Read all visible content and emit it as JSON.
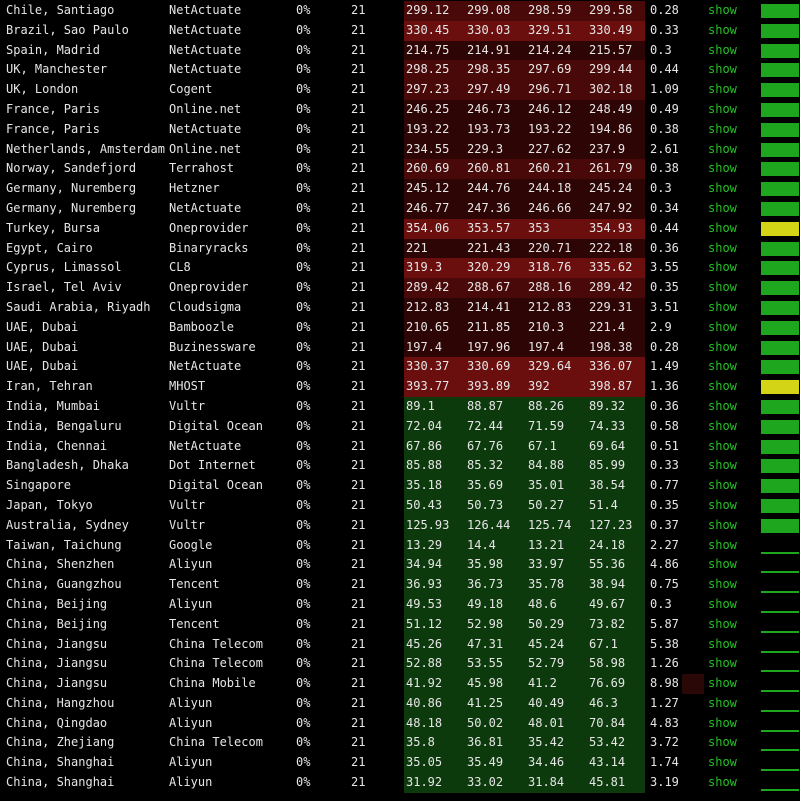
{
  "colors": {
    "band_red_strong": "#6b0e0e",
    "band_red_mid": "#4a0909",
    "band_red_dark": "#2d0505",
    "band_green": "#0d3a0d",
    "link_green": "#25c025",
    "bar_green": "#1ea61e",
    "bar_yellow": "#d4d417"
  },
  "link_label": "show",
  "rows": [
    {
      "location": "Chile, Santiago",
      "provider": "NetActuate",
      "loss": "0%",
      "sent": "21",
      "last": "299.12",
      "avg": "299.08",
      "best": "298.59",
      "worst": "299.58",
      "stdev": "0.28",
      "band": "red",
      "bar": "green"
    },
    {
      "location": "Brazil, Sao Paulo",
      "provider": "NetActuate",
      "loss": "0%",
      "sent": "21",
      "last": "330.45",
      "avg": "330.03",
      "best": "329.51",
      "worst": "330.49",
      "stdev": "0.33",
      "band": "red_strong",
      "bar": "green"
    },
    {
      "location": "Spain, Madrid",
      "provider": "NetActuate",
      "loss": "0%",
      "sent": "21",
      "last": "214.75",
      "avg": "214.91",
      "best": "214.24",
      "worst": "215.57",
      "stdev": "0.3",
      "band": "red_dark",
      "bar": "green"
    },
    {
      "location": "UK, Manchester",
      "provider": "NetActuate",
      "loss": "0%",
      "sent": "21",
      "last": "298.25",
      "avg": "298.35",
      "best": "297.69",
      "worst": "299.44",
      "stdev": "0.44",
      "band": "red",
      "bar": "green"
    },
    {
      "location": "UK, London",
      "provider": "Cogent",
      "loss": "0%",
      "sent": "21",
      "last": "297.23",
      "avg": "297.49",
      "best": "296.71",
      "worst": "302.18",
      "stdev": "1.09",
      "band": "red",
      "bar": "green"
    },
    {
      "location": "France, Paris",
      "provider": "Online.net",
      "loss": "0%",
      "sent": "21",
      "last": "246.25",
      "avg": "246.73",
      "best": "246.12",
      "worst": "248.49",
      "stdev": "0.49",
      "band": "red_dark",
      "bar": "green"
    },
    {
      "location": "France, Paris",
      "provider": "NetActuate",
      "loss": "0%",
      "sent": "21",
      "last": "193.22",
      "avg": "193.73",
      "best": "193.22",
      "worst": "194.86",
      "stdev": "0.38",
      "band": "red_dark",
      "bar": "green"
    },
    {
      "location": "Netherlands, Amsterdam",
      "provider": "Online.net",
      "loss": "0%",
      "sent": "21",
      "last": "234.55",
      "avg": "229.3",
      "best": "227.62",
      "worst": "237.9",
      "stdev": "2.61",
      "band": "red_dark",
      "bar": "green"
    },
    {
      "location": "Norway, Sandefjord",
      "provider": "Terrahost",
      "loss": "0%",
      "sent": "21",
      "last": "260.69",
      "avg": "260.81",
      "best": "260.21",
      "worst": "261.79",
      "stdev": "0.38",
      "band": "red",
      "bar": "green"
    },
    {
      "location": "Germany, Nuremberg",
      "provider": "Hetzner",
      "loss": "0%",
      "sent": "21",
      "last": "245.12",
      "avg": "244.76",
      "best": "244.18",
      "worst": "245.24",
      "stdev": "0.3",
      "band": "red_dark",
      "bar": "green"
    },
    {
      "location": "Germany, Nuremberg",
      "provider": "NetActuate",
      "loss": "0%",
      "sent": "21",
      "last": "246.77",
      "avg": "247.36",
      "best": "246.66",
      "worst": "247.92",
      "stdev": "0.34",
      "band": "red_dark",
      "bar": "green"
    },
    {
      "location": "Turkey, Bursa",
      "provider": "Oneprovider",
      "loss": "0%",
      "sent": "21",
      "last": "354.06",
      "avg": "353.57",
      "best": "353",
      "worst": "354.93",
      "stdev": "0.44",
      "band": "red_strong",
      "bar": "yellow"
    },
    {
      "location": "Egypt, Cairo",
      "provider": "Binaryracks",
      "loss": "0%",
      "sent": "21",
      "last": "221",
      "avg": "221.43",
      "best": "220.71",
      "worst": "222.18",
      "stdev": "0.36",
      "band": "red_dark",
      "bar": "green"
    },
    {
      "location": "Cyprus, Limassol",
      "provider": "CL8",
      "loss": "0%",
      "sent": "21",
      "last": "319.3",
      "avg": "320.29",
      "best": "318.76",
      "worst": "335.62",
      "stdev": "3.55",
      "band": "red_strong",
      "bar": "green"
    },
    {
      "location": "Israel, Tel Aviv",
      "provider": "Oneprovider",
      "loss": "0%",
      "sent": "21",
      "last": "289.42",
      "avg": "288.67",
      "best": "288.16",
      "worst": "289.42",
      "stdev": "0.35",
      "band": "red",
      "bar": "green"
    },
    {
      "location": "Saudi Arabia, Riyadh",
      "provider": "Cloudsigma",
      "loss": "0%",
      "sent": "21",
      "last": "212.83",
      "avg": "214.41",
      "best": "212.83",
      "worst": "229.31",
      "stdev": "3.51",
      "band": "red_dark",
      "bar": "green"
    },
    {
      "location": "UAE, Dubai",
      "provider": "Bamboozle",
      "loss": "0%",
      "sent": "21",
      "last": "210.65",
      "avg": "211.85",
      "best": "210.3",
      "worst": "221.4",
      "stdev": "2.9",
      "band": "red_dark",
      "bar": "green"
    },
    {
      "location": "UAE, Dubai",
      "provider": "Buzinessware",
      "loss": "0%",
      "sent": "21",
      "last": "197.4",
      "avg": "197.96",
      "best": "197.4",
      "worst": "198.38",
      "stdev": "0.28",
      "band": "red_dark",
      "bar": "green"
    },
    {
      "location": "UAE, Dubai",
      "provider": "NetActuate",
      "loss": "0%",
      "sent": "21",
      "last": "330.37",
      "avg": "330.69",
      "best": "329.64",
      "worst": "336.07",
      "stdev": "1.49",
      "band": "red_strong",
      "bar": "green"
    },
    {
      "location": "Iran, Tehran",
      "provider": "MHOST",
      "loss": "0%",
      "sent": "21",
      "last": "393.77",
      "avg": "393.89",
      "best": "392",
      "worst": "398.87",
      "stdev": "1.36",
      "band": "red_strong",
      "bar": "yellow"
    },
    {
      "location": "India, Mumbai",
      "provider": "Vultr",
      "loss": "0%",
      "sent": "21",
      "last": "89.1",
      "avg": "88.87",
      "best": "88.26",
      "worst": "89.32",
      "stdev": "0.36",
      "band": "green",
      "bar": "green"
    },
    {
      "location": "India, Bengaluru",
      "provider": "Digital Ocean",
      "loss": "0%",
      "sent": "21",
      "last": "72.04",
      "avg": "72.44",
      "best": "71.59",
      "worst": "74.33",
      "stdev": "0.58",
      "band": "green",
      "bar": "green"
    },
    {
      "location": "India, Chennai",
      "provider": "NetActuate",
      "loss": "0%",
      "sent": "21",
      "last": "67.86",
      "avg": "67.76",
      "best": "67.1",
      "worst": "69.64",
      "stdev": "0.51",
      "band": "green",
      "bar": "green"
    },
    {
      "location": "Bangladesh, Dhaka",
      "provider": "Dot Internet",
      "loss": "0%",
      "sent": "21",
      "last": "85.88",
      "avg": "85.32",
      "best": "84.88",
      "worst": "85.99",
      "stdev": "0.33",
      "band": "green",
      "bar": "green"
    },
    {
      "location": "Singapore",
      "provider": "Digital Ocean",
      "loss": "0%",
      "sent": "21",
      "last": "35.18",
      "avg": "35.69",
      "best": "35.01",
      "worst": "38.54",
      "stdev": "0.77",
      "band": "green",
      "bar": "green"
    },
    {
      "location": "Japan, Tokyo",
      "provider": "Vultr",
      "loss": "0%",
      "sent": "21",
      "last": "50.43",
      "avg": "50.73",
      "best": "50.27",
      "worst": "51.4",
      "stdev": "0.35",
      "band": "green",
      "bar": "green"
    },
    {
      "location": "Australia, Sydney",
      "provider": "Vultr",
      "loss": "0%",
      "sent": "21",
      "last": "125.93",
      "avg": "126.44",
      "best": "125.74",
      "worst": "127.23",
      "stdev": "0.37",
      "band": "green",
      "bar": "green"
    },
    {
      "location": "Taiwan, Taichung",
      "provider": "Google",
      "loss": "0%",
      "sent": "21",
      "last": "13.29",
      "avg": "14.4",
      "best": "13.21",
      "worst": "24.18",
      "stdev": "2.27",
      "band": "green",
      "bar": "sparse"
    },
    {
      "location": "China, Shenzhen",
      "provider": "Aliyun",
      "loss": "0%",
      "sent": "21",
      "last": "34.94",
      "avg": "35.98",
      "best": "33.97",
      "worst": "55.36",
      "stdev": "4.86",
      "band": "green",
      "bar": "sparse"
    },
    {
      "location": "China, Guangzhou",
      "provider": "Tencent",
      "loss": "0%",
      "sent": "21",
      "last": "36.93",
      "avg": "36.73",
      "best": "35.78",
      "worst": "38.94",
      "stdev": "0.75",
      "band": "green",
      "bar": "sparse"
    },
    {
      "location": "China, Beijing",
      "provider": "Aliyun",
      "loss": "0%",
      "sent": "21",
      "last": "49.53",
      "avg": "49.18",
      "best": "48.6",
      "worst": "49.67",
      "stdev": "0.3",
      "band": "green",
      "bar": "sparse"
    },
    {
      "location": "China, Beijing",
      "provider": "Tencent",
      "loss": "0%",
      "sent": "21",
      "last": "51.12",
      "avg": "52.98",
      "best": "50.29",
      "worst": "73.82",
      "stdev": "5.87",
      "band": "green",
      "bar": "sparse"
    },
    {
      "location": "China, Jiangsu",
      "provider": "China Telecom",
      "loss": "0%",
      "sent": "21",
      "last": "45.26",
      "avg": "47.31",
      "best": "45.24",
      "worst": "67.1",
      "stdev": "5.38",
      "band": "green",
      "bar": "sparse"
    },
    {
      "location": "China, Jiangsu",
      "provider": "China Telecom",
      "loss": "0%",
      "sent": "21",
      "last": "52.88",
      "avg": "53.55",
      "best": "52.79",
      "worst": "58.98",
      "stdev": "1.26",
      "band": "green",
      "bar": "sparse"
    },
    {
      "location": "China, Jiangsu",
      "provider": "China Mobile",
      "loss": "0%",
      "sent": "21",
      "last": "41.92",
      "avg": "45.98",
      "best": "41.2",
      "worst": "76.69",
      "stdev": "8.98",
      "band": "green",
      "bar": "sparse",
      "stdev_highlight": true
    },
    {
      "location": "China, Hangzhou",
      "provider": "Aliyun",
      "loss": "0%",
      "sent": "21",
      "last": "40.86",
      "avg": "41.25",
      "best": "40.49",
      "worst": "46.3",
      "stdev": "1.27",
      "band": "green",
      "bar": "sparse"
    },
    {
      "location": "China, Qingdao",
      "provider": "Aliyun",
      "loss": "0%",
      "sent": "21",
      "last": "48.18",
      "avg": "50.02",
      "best": "48.01",
      "worst": "70.84",
      "stdev": "4.83",
      "band": "green",
      "bar": "sparse"
    },
    {
      "location": "China, Zhejiang",
      "provider": "China Telecom",
      "loss": "0%",
      "sent": "21",
      "last": "35.8",
      "avg": "36.81",
      "best": "35.42",
      "worst": "53.42",
      "stdev": "3.72",
      "band": "green",
      "bar": "sparse"
    },
    {
      "location": "China, Shanghai",
      "provider": "Aliyun",
      "loss": "0%",
      "sent": "21",
      "last": "35.05",
      "avg": "35.49",
      "best": "34.46",
      "worst": "43.14",
      "stdev": "1.74",
      "band": "green",
      "bar": "sparse"
    },
    {
      "location": "China, Shanghai",
      "provider": "Aliyun",
      "loss": "0%",
      "sent": "21",
      "last": "31.92",
      "avg": "33.02",
      "best": "31.84",
      "worst": "45.81",
      "stdev": "3.19",
      "band": "green",
      "bar": "sparse"
    }
  ]
}
